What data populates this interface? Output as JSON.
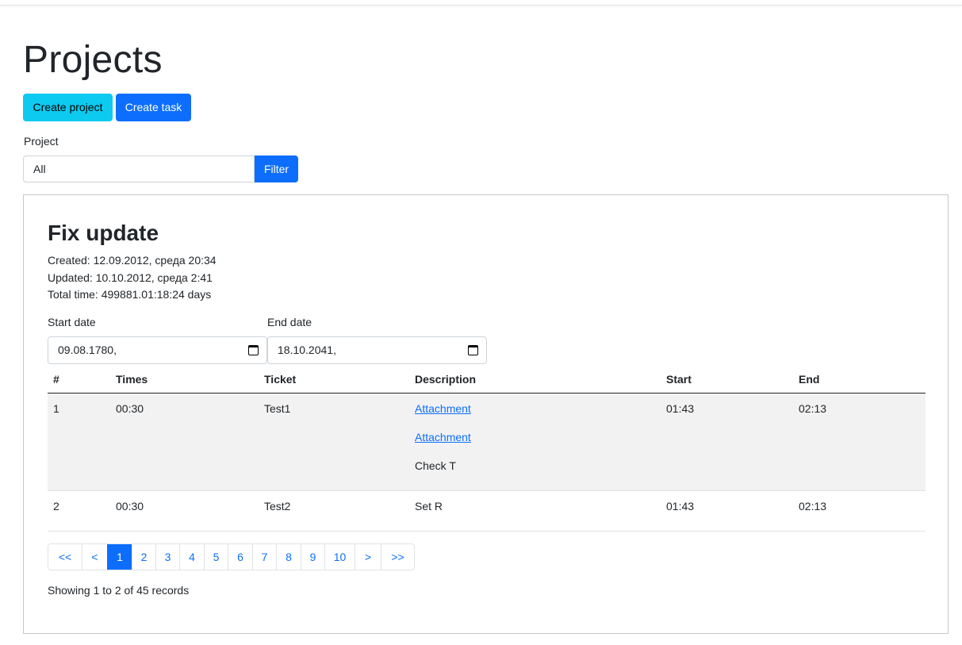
{
  "page": {
    "title": "Projects"
  },
  "actions": {
    "create_project": "Create project",
    "create_task": "Create task"
  },
  "filter": {
    "label": "Project",
    "selected": "All",
    "button": "Filter"
  },
  "project": {
    "title": "Fix update",
    "created": "Created: 12.09.2012, среда 20:34",
    "updated": "Updated: 10.10.2012, среда 2:41",
    "total_time": "Total time: 499881.01:18:24 days",
    "start_label": "Start date",
    "start_value": "09.08.1780,",
    "end_label": "End date",
    "end_value": "18.10.2041,"
  },
  "table": {
    "headers": [
      "#",
      "Times",
      "Ticket",
      "Description",
      "Start",
      "End"
    ],
    "rows": [
      {
        "num": "1",
        "times": "00:30",
        "ticket": "Test1",
        "desc_links": [
          "Attachment",
          "Attachment"
        ],
        "desc_text": "Check T",
        "start": "01:43",
        "end": "02:13"
      },
      {
        "num": "2",
        "times": "00:30",
        "ticket": "Test2",
        "desc_text": "Set R",
        "start": "01:43",
        "end": "02:13"
      }
    ]
  },
  "pagination": {
    "first": "<<",
    "prev": "<",
    "pages": [
      "1",
      "2",
      "3",
      "4",
      "5",
      "6",
      "7",
      "8",
      "9",
      "10"
    ],
    "next": ">",
    "last": ">>",
    "active": "1"
  },
  "summary": "Showing 1 to 2 of 45 records",
  "colors": {
    "primary": "#0d6efd",
    "info": "#0dcaf0",
    "row_stripe": "#f2f2f2"
  }
}
